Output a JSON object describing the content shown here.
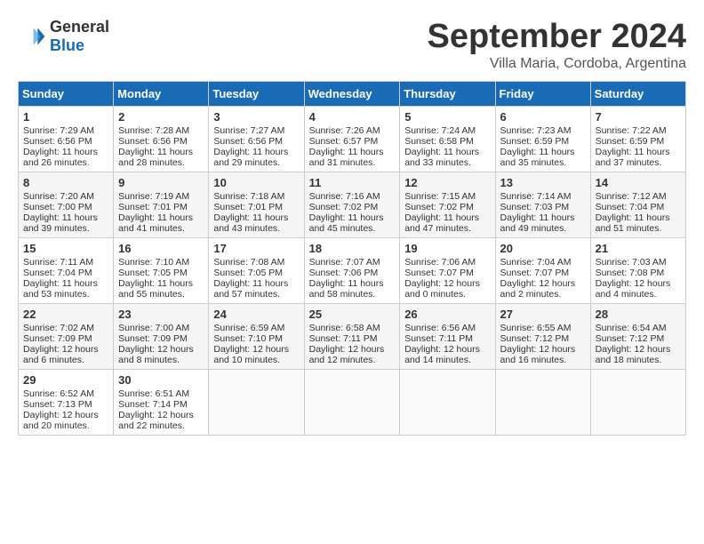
{
  "header": {
    "logo_general": "General",
    "logo_blue": "Blue",
    "month_title": "September 2024",
    "location": "Villa Maria, Cordoba, Argentina"
  },
  "days_of_week": [
    "Sunday",
    "Monday",
    "Tuesday",
    "Wednesday",
    "Thursday",
    "Friday",
    "Saturday"
  ],
  "weeks": [
    [
      {
        "day": "1",
        "sunrise": "Sunrise: 7:29 AM",
        "sunset": "Sunset: 6:56 PM",
        "daylight": "Daylight: 11 hours and 26 minutes."
      },
      {
        "day": "2",
        "sunrise": "Sunrise: 7:28 AM",
        "sunset": "Sunset: 6:56 PM",
        "daylight": "Daylight: 11 hours and 28 minutes."
      },
      {
        "day": "3",
        "sunrise": "Sunrise: 7:27 AM",
        "sunset": "Sunset: 6:56 PM",
        "daylight": "Daylight: 11 hours and 29 minutes."
      },
      {
        "day": "4",
        "sunrise": "Sunrise: 7:26 AM",
        "sunset": "Sunset: 6:57 PM",
        "daylight": "Daylight: 11 hours and 31 minutes."
      },
      {
        "day": "5",
        "sunrise": "Sunrise: 7:24 AM",
        "sunset": "Sunset: 6:58 PM",
        "daylight": "Daylight: 11 hours and 33 minutes."
      },
      {
        "day": "6",
        "sunrise": "Sunrise: 7:23 AM",
        "sunset": "Sunset: 6:59 PM",
        "daylight": "Daylight: 11 hours and 35 minutes."
      },
      {
        "day": "7",
        "sunrise": "Sunrise: 7:22 AM",
        "sunset": "Sunset: 6:59 PM",
        "daylight": "Daylight: 11 hours and 37 minutes."
      }
    ],
    [
      {
        "day": "8",
        "sunrise": "Sunrise: 7:20 AM",
        "sunset": "Sunset: 7:00 PM",
        "daylight": "Daylight: 11 hours and 39 minutes."
      },
      {
        "day": "9",
        "sunrise": "Sunrise: 7:19 AM",
        "sunset": "Sunset: 7:01 PM",
        "daylight": "Daylight: 11 hours and 41 minutes."
      },
      {
        "day": "10",
        "sunrise": "Sunrise: 7:18 AM",
        "sunset": "Sunset: 7:01 PM",
        "daylight": "Daylight: 11 hours and 43 minutes."
      },
      {
        "day": "11",
        "sunrise": "Sunrise: 7:16 AM",
        "sunset": "Sunset: 7:02 PM",
        "daylight": "Daylight: 11 hours and 45 minutes."
      },
      {
        "day": "12",
        "sunrise": "Sunrise: 7:15 AM",
        "sunset": "Sunset: 7:02 PM",
        "daylight": "Daylight: 11 hours and 47 minutes."
      },
      {
        "day": "13",
        "sunrise": "Sunrise: 7:14 AM",
        "sunset": "Sunset: 7:03 PM",
        "daylight": "Daylight: 11 hours and 49 minutes."
      },
      {
        "day": "14",
        "sunrise": "Sunrise: 7:12 AM",
        "sunset": "Sunset: 7:04 PM",
        "daylight": "Daylight: 11 hours and 51 minutes."
      }
    ],
    [
      {
        "day": "15",
        "sunrise": "Sunrise: 7:11 AM",
        "sunset": "Sunset: 7:04 PM",
        "daylight": "Daylight: 11 hours and 53 minutes."
      },
      {
        "day": "16",
        "sunrise": "Sunrise: 7:10 AM",
        "sunset": "Sunset: 7:05 PM",
        "daylight": "Daylight: 11 hours and 55 minutes."
      },
      {
        "day": "17",
        "sunrise": "Sunrise: 7:08 AM",
        "sunset": "Sunset: 7:05 PM",
        "daylight": "Daylight: 11 hours and 57 minutes."
      },
      {
        "day": "18",
        "sunrise": "Sunrise: 7:07 AM",
        "sunset": "Sunset: 7:06 PM",
        "daylight": "Daylight: 11 hours and 58 minutes."
      },
      {
        "day": "19",
        "sunrise": "Sunrise: 7:06 AM",
        "sunset": "Sunset: 7:07 PM",
        "daylight": "Daylight: 12 hours and 0 minutes."
      },
      {
        "day": "20",
        "sunrise": "Sunrise: 7:04 AM",
        "sunset": "Sunset: 7:07 PM",
        "daylight": "Daylight: 12 hours and 2 minutes."
      },
      {
        "day": "21",
        "sunrise": "Sunrise: 7:03 AM",
        "sunset": "Sunset: 7:08 PM",
        "daylight": "Daylight: 12 hours and 4 minutes."
      }
    ],
    [
      {
        "day": "22",
        "sunrise": "Sunrise: 7:02 AM",
        "sunset": "Sunset: 7:09 PM",
        "daylight": "Daylight: 12 hours and 6 minutes."
      },
      {
        "day": "23",
        "sunrise": "Sunrise: 7:00 AM",
        "sunset": "Sunset: 7:09 PM",
        "daylight": "Daylight: 12 hours and 8 minutes."
      },
      {
        "day": "24",
        "sunrise": "Sunrise: 6:59 AM",
        "sunset": "Sunset: 7:10 PM",
        "daylight": "Daylight: 12 hours and 10 minutes."
      },
      {
        "day": "25",
        "sunrise": "Sunrise: 6:58 AM",
        "sunset": "Sunset: 7:11 PM",
        "daylight": "Daylight: 12 hours and 12 minutes."
      },
      {
        "day": "26",
        "sunrise": "Sunrise: 6:56 AM",
        "sunset": "Sunset: 7:11 PM",
        "daylight": "Daylight: 12 hours and 14 minutes."
      },
      {
        "day": "27",
        "sunrise": "Sunrise: 6:55 AM",
        "sunset": "Sunset: 7:12 PM",
        "daylight": "Daylight: 12 hours and 16 minutes."
      },
      {
        "day": "28",
        "sunrise": "Sunrise: 6:54 AM",
        "sunset": "Sunset: 7:12 PM",
        "daylight": "Daylight: 12 hours and 18 minutes."
      }
    ],
    [
      {
        "day": "29",
        "sunrise": "Sunrise: 6:52 AM",
        "sunset": "Sunset: 7:13 PM",
        "daylight": "Daylight: 12 hours and 20 minutes."
      },
      {
        "day": "30",
        "sunrise": "Sunrise: 6:51 AM",
        "sunset": "Sunset: 7:14 PM",
        "daylight": "Daylight: 12 hours and 22 minutes."
      },
      null,
      null,
      null,
      null,
      null
    ]
  ]
}
